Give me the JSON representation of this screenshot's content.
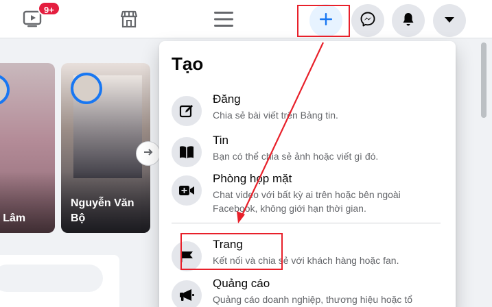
{
  "topbar": {
    "watch_badge": "9+",
    "icons": {
      "watch": "video-play-icon",
      "marketplace": "storefront-icon",
      "menu": "hamburger-menu-icon",
      "create": "plus-icon",
      "messenger": "messenger-icon",
      "notifications": "bell-icon",
      "account": "caret-down-icon"
    }
  },
  "stories": [
    {
      "name": "n Lâm"
    },
    {
      "name": "Nguyễn Văn Bộ"
    }
  ],
  "create_menu": {
    "title": "Tạo",
    "items": [
      {
        "title": "Đăng",
        "description": "Chia sẻ bài viết trên Bảng tin.",
        "icon": "compose-icon"
      },
      {
        "title": "Tin",
        "description": "Bạn có thể chia sẻ ảnh hoặc viết gì đó.",
        "icon": "book-open-icon"
      },
      {
        "title": "Phòng họp mặt",
        "description": "Chat video với bất kỳ ai trên hoặc bên ngoài Facebook, không giới hạn thời gian.",
        "icon": "video-plus-icon"
      },
      {
        "title": "Trang",
        "description": "Kết nối và chia sẻ với khách hàng hoặc fan.",
        "icon": "flag-icon"
      },
      {
        "title": "Quảng cáo",
        "description": "Quảng cáo doanh nghiệp, thương hiệu hoặc tổ",
        "icon": "megaphone-icon"
      }
    ]
  },
  "colors": {
    "accent": "#1877f2",
    "annotation": "#e8202a",
    "badge": "#e41e3f",
    "icon_bg": "#e4e6eb",
    "secondary_text": "#65676b"
  }
}
